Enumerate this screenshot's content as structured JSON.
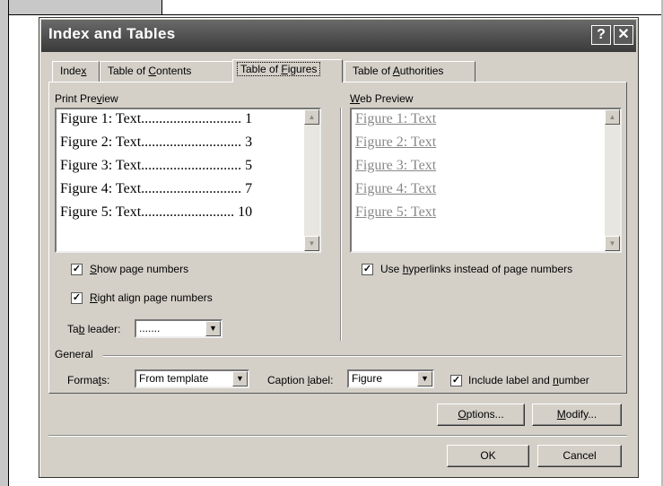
{
  "dialog": {
    "title": "Index and Tables",
    "help_glyph": "?",
    "close_glyph": "✕"
  },
  "tabs": [
    {
      "pre": "Inde",
      "key": "x",
      "post": ""
    },
    {
      "pre": "Table of ",
      "key": "C",
      "post": "ontents"
    },
    {
      "pre": "Table of ",
      "key": "F",
      "post": "igures"
    },
    {
      "pre": "Table of ",
      "key": "A",
      "post": "uthorities"
    }
  ],
  "print_preview": {
    "label_pre": "Print Pre",
    "label_key": "v",
    "label_post": "iew",
    "rows": [
      "Figure 1: Text............................ 1",
      "Figure 2: Text............................ 3",
      "Figure 3: Text............................ 5",
      "Figure 4: Text............................ 7",
      "Figure 5: Text.......................... 10"
    ]
  },
  "web_preview": {
    "label_key": "W",
    "label_post": "eb Preview",
    "rows": [
      "Figure 1: Text",
      "Figure 2: Text",
      "Figure 3: Text",
      "Figure 4: Text",
      "Figure 5: Text"
    ]
  },
  "options": {
    "show_page_numbers": {
      "key": "S",
      "post": "how page numbers",
      "checked": true
    },
    "right_align": {
      "key": "R",
      "post": "ight align page numbers",
      "checked": true
    },
    "tab_leader": {
      "pre": "Ta",
      "key": "b",
      "post": " leader:",
      "value": "......."
    },
    "use_hyperlinks": {
      "pre": "Use ",
      "key": "h",
      "post": "yperlinks instead of page numbers",
      "checked": true
    }
  },
  "general": {
    "label": "General",
    "formats": {
      "pre": "Forma",
      "key": "t",
      "post": "s:",
      "value": "From template"
    },
    "caption": {
      "pre": "Caption ",
      "key": "l",
      "post": "abel:",
      "value": "Figure"
    },
    "include": {
      "pre": "Include label and ",
      "key": "n",
      "post": "umber",
      "checked": true
    }
  },
  "buttons": {
    "options": {
      "key": "O",
      "post": "ptions..."
    },
    "modify": {
      "key": "M",
      "post": "odify..."
    },
    "ok": "OK",
    "cancel": "Cancel"
  },
  "glyphs": {
    "check": "✓",
    "down": "▼",
    "up": "▲"
  }
}
